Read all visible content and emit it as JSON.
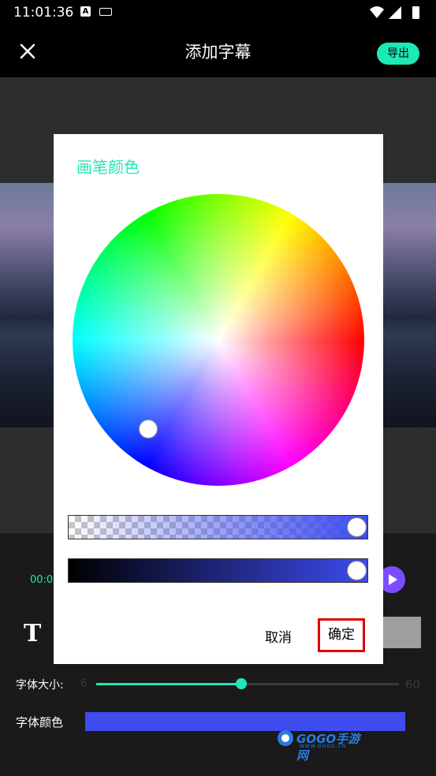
{
  "status_bar": {
    "time": "11:01:36",
    "a_icon": "A"
  },
  "app_bar": {
    "title": "添加字幕",
    "export_label": "导出"
  },
  "bottom": {
    "time_start": "00:0",
    "text_icon": "T",
    "font_size_label": "字体大小:",
    "font_size_min": "6",
    "font_size_max": "60",
    "font_size_fraction": 0.48,
    "font_color_label": "字体颜色",
    "font_color": "#3d4bef"
  },
  "dialog": {
    "title": "画笔颜色",
    "cancel_label": "取消",
    "ok_label": "确定",
    "alpha": 1.0,
    "value": 1.0
  },
  "watermark": {
    "text": "GOGO手游网",
    "sub": "WWW.GOGO.CN"
  },
  "colors": {
    "accent": "#1de9b6",
    "play": "#7c4dff",
    "selected": "#3d4bef",
    "highlight": "#e00000"
  }
}
